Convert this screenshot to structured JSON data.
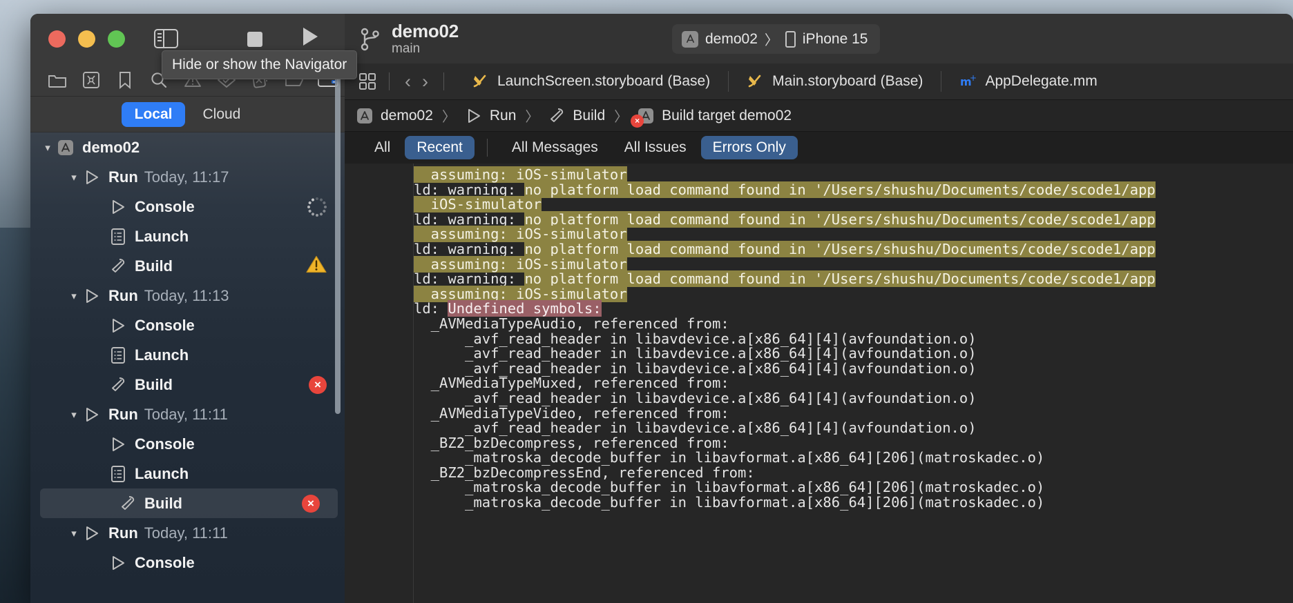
{
  "window": {
    "traffic_lights": [
      "close",
      "minimize",
      "zoom"
    ],
    "tooltip": "Hide or show the Navigator",
    "scheme": {
      "name": "demo02",
      "branch": "main"
    },
    "run_destination": {
      "scheme": "demo02",
      "separator": "〉",
      "device": "iPhone 15"
    }
  },
  "navigator": {
    "toolbar_icons": [
      "folder-icon",
      "source-control-icon",
      "bookmark-icon",
      "search-icon",
      "issue-warning-icon",
      "test-icon",
      "debug-icon",
      "breakpoint-icon",
      "report-icon"
    ],
    "segments": [
      {
        "label": "Local",
        "active": true
      },
      {
        "label": "Cloud",
        "active": false
      }
    ],
    "tree": [
      {
        "depth": 0,
        "twisty": "down",
        "icon": "app-icon",
        "label": "demo02",
        "time": "",
        "badge": "",
        "selected": false
      },
      {
        "depth": 1,
        "twisty": "down",
        "icon": "run-icon",
        "label": "Run",
        "time": "Today, 11:17",
        "badge": "",
        "selected": false
      },
      {
        "depth": 2,
        "twisty": "",
        "icon": "console-icon",
        "label": "Console",
        "time": "",
        "badge": "spinner",
        "selected": false
      },
      {
        "depth": 2,
        "twisty": "",
        "icon": "launch-icon",
        "label": "Launch",
        "time": "",
        "badge": "",
        "selected": false
      },
      {
        "depth": 2,
        "twisty": "",
        "icon": "build-icon",
        "label": "Build",
        "time": "",
        "badge": "warning",
        "selected": false
      },
      {
        "depth": 1,
        "twisty": "down",
        "icon": "run-icon",
        "label": "Run",
        "time": "Today, 11:13",
        "badge": "",
        "selected": false
      },
      {
        "depth": 2,
        "twisty": "",
        "icon": "console-icon",
        "label": "Console",
        "time": "",
        "badge": "",
        "selected": false
      },
      {
        "depth": 2,
        "twisty": "",
        "icon": "launch-icon",
        "label": "Launch",
        "time": "",
        "badge": "",
        "selected": false
      },
      {
        "depth": 2,
        "twisty": "",
        "icon": "build-icon",
        "label": "Build",
        "time": "",
        "badge": "error",
        "selected": false
      },
      {
        "depth": 1,
        "twisty": "down",
        "icon": "run-icon",
        "label": "Run",
        "time": "Today, 11:11",
        "badge": "",
        "selected": false
      },
      {
        "depth": 2,
        "twisty": "",
        "icon": "console-icon",
        "label": "Console",
        "time": "",
        "badge": "",
        "selected": false
      },
      {
        "depth": 2,
        "twisty": "",
        "icon": "launch-icon",
        "label": "Launch",
        "time": "",
        "badge": "",
        "selected": false
      },
      {
        "depth": 2,
        "twisty": "",
        "icon": "build-icon",
        "label": "Build",
        "time": "",
        "badge": "error",
        "selected": true
      },
      {
        "depth": 1,
        "twisty": "down",
        "icon": "run-icon",
        "label": "Run",
        "time": "Today, 11:11",
        "badge": "",
        "selected": false
      },
      {
        "depth": 2,
        "twisty": "",
        "icon": "console-icon",
        "label": "Console",
        "time": "",
        "badge": "",
        "selected": false
      }
    ]
  },
  "editor": {
    "tabs": [
      {
        "label": "LaunchScreen.storyboard (Base)",
        "icon": "interface-builder-icon"
      },
      {
        "label": "Main.storyboard (Base)",
        "icon": "interface-builder-icon"
      },
      {
        "label": "AppDelegate.mm",
        "icon": "objc-mm-icon"
      }
    ],
    "breadcrumb": [
      {
        "label": "demo02",
        "icon": "app-icon",
        "error": false
      },
      {
        "label": "Run",
        "icon": "run-icon",
        "error": false
      },
      {
        "label": "Build",
        "icon": "build-icon",
        "error": false
      },
      {
        "label": "Build target demo02",
        "icon": "app-icon",
        "error": true
      }
    ],
    "breadcrumb_separator": "〉",
    "filters": [
      {
        "label": "All",
        "active": false
      },
      {
        "label": "Recent",
        "active": true
      },
      {
        "label": "All Messages",
        "active": false
      },
      {
        "label": "All Issues",
        "active": false
      },
      {
        "label": "Errors Only",
        "active": true
      }
    ]
  },
  "colors": {
    "accent_blue": "#2f7df6",
    "filter_active": "#3a5f8f",
    "error_red": "#e8453c",
    "warning_yellow": "#f0b429",
    "warn_highlight": "#8c8342",
    "error_highlight": "#9a6066",
    "annotation_arrow": "#ff1a00"
  },
  "log": {
    "lines": [
      {
        "segs": [
          {
            "t": "  assuming: iOS-simulator",
            "s": "hl-warn"
          }
        ]
      },
      {
        "segs": [
          {
            "t": "ld: warning: ",
            "s": ""
          },
          {
            "t": "no platform load command found in '/Users/shushu/Documents/code/scode1/app",
            "s": "hl-warn"
          }
        ]
      },
      {
        "segs": [
          {
            "t": "  iOS-simulator",
            "s": "hl-warn"
          }
        ]
      },
      {
        "segs": [
          {
            "t": "ld: warning: ",
            "s": ""
          },
          {
            "t": "no platform load command found in '/Users/shushu/Documents/code/scode1/app",
            "s": "hl-warn"
          }
        ]
      },
      {
        "segs": [
          {
            "t": "  assuming: iOS-simulator",
            "s": "hl-warn"
          }
        ]
      },
      {
        "segs": [
          {
            "t": "ld: warning: ",
            "s": ""
          },
          {
            "t": "no platform load command found in '/Users/shushu/Documents/code/scode1/app",
            "s": "hl-warn"
          }
        ]
      },
      {
        "segs": [
          {
            "t": "  assuming: iOS-simulator",
            "s": "hl-warn"
          }
        ]
      },
      {
        "segs": [
          {
            "t": "ld: warning: ",
            "s": ""
          },
          {
            "t": "no platform load command found in '/Users/shushu/Documents/code/scode1/app",
            "s": "hl-warn"
          }
        ]
      },
      {
        "segs": [
          {
            "t": "  assuming: iOS-simulator",
            "s": "hl-warn"
          }
        ]
      },
      {
        "segs": [
          {
            "t": "ld: ",
            "s": ""
          },
          {
            "t": "Undefined symbols:",
            "s": "hl-err"
          }
        ]
      },
      {
        "segs": [
          {
            "t": "  _AVMediaTypeAudio, referenced from:",
            "s": ""
          }
        ]
      },
      {
        "segs": [
          {
            "t": "      _avf_read_header in libavdevice.a[x86_64][4](avfoundation.o)",
            "s": ""
          }
        ]
      },
      {
        "segs": [
          {
            "t": "      _avf_read_header in libavdevice.a[x86_64][4](avfoundation.o)",
            "s": ""
          }
        ]
      },
      {
        "segs": [
          {
            "t": "      _avf_read_header in libavdevice.a[x86_64][4](avfoundation.o)",
            "s": ""
          }
        ]
      },
      {
        "segs": [
          {
            "t": "  _AVMediaTypeMuxed, referenced from:",
            "s": ""
          }
        ]
      },
      {
        "segs": [
          {
            "t": "      _avf_read_header in libavdevice.a[x86_64][4](avfoundation.o)",
            "s": ""
          }
        ]
      },
      {
        "segs": [
          {
            "t": "  _AVMediaTypeVideo, referenced from:",
            "s": ""
          }
        ]
      },
      {
        "segs": [
          {
            "t": "      _avf_read_header in libavdevice.a[x86_64][4](avfoundation.o)",
            "s": ""
          }
        ]
      },
      {
        "segs": [
          {
            "t": "  _BZ2_bzDecompress, referenced from:",
            "s": ""
          }
        ]
      },
      {
        "segs": [
          {
            "t": "      _matroska_decode_buffer in libavformat.a[x86_64][206](matroskadec.o)",
            "s": ""
          }
        ]
      },
      {
        "segs": [
          {
            "t": "  _BZ2_bzDecompressEnd, referenced from:",
            "s": ""
          }
        ]
      },
      {
        "segs": [
          {
            "t": "      _matroska_decode_buffer in libavformat.a[x86_64][206](matroskadec.o)",
            "s": ""
          }
        ]
      },
      {
        "segs": [
          {
            "t": "      _matroska_decode_buffer in libavformat.a[x86_64][206](matroskadec.o)",
            "s": ""
          }
        ]
      }
    ]
  }
}
